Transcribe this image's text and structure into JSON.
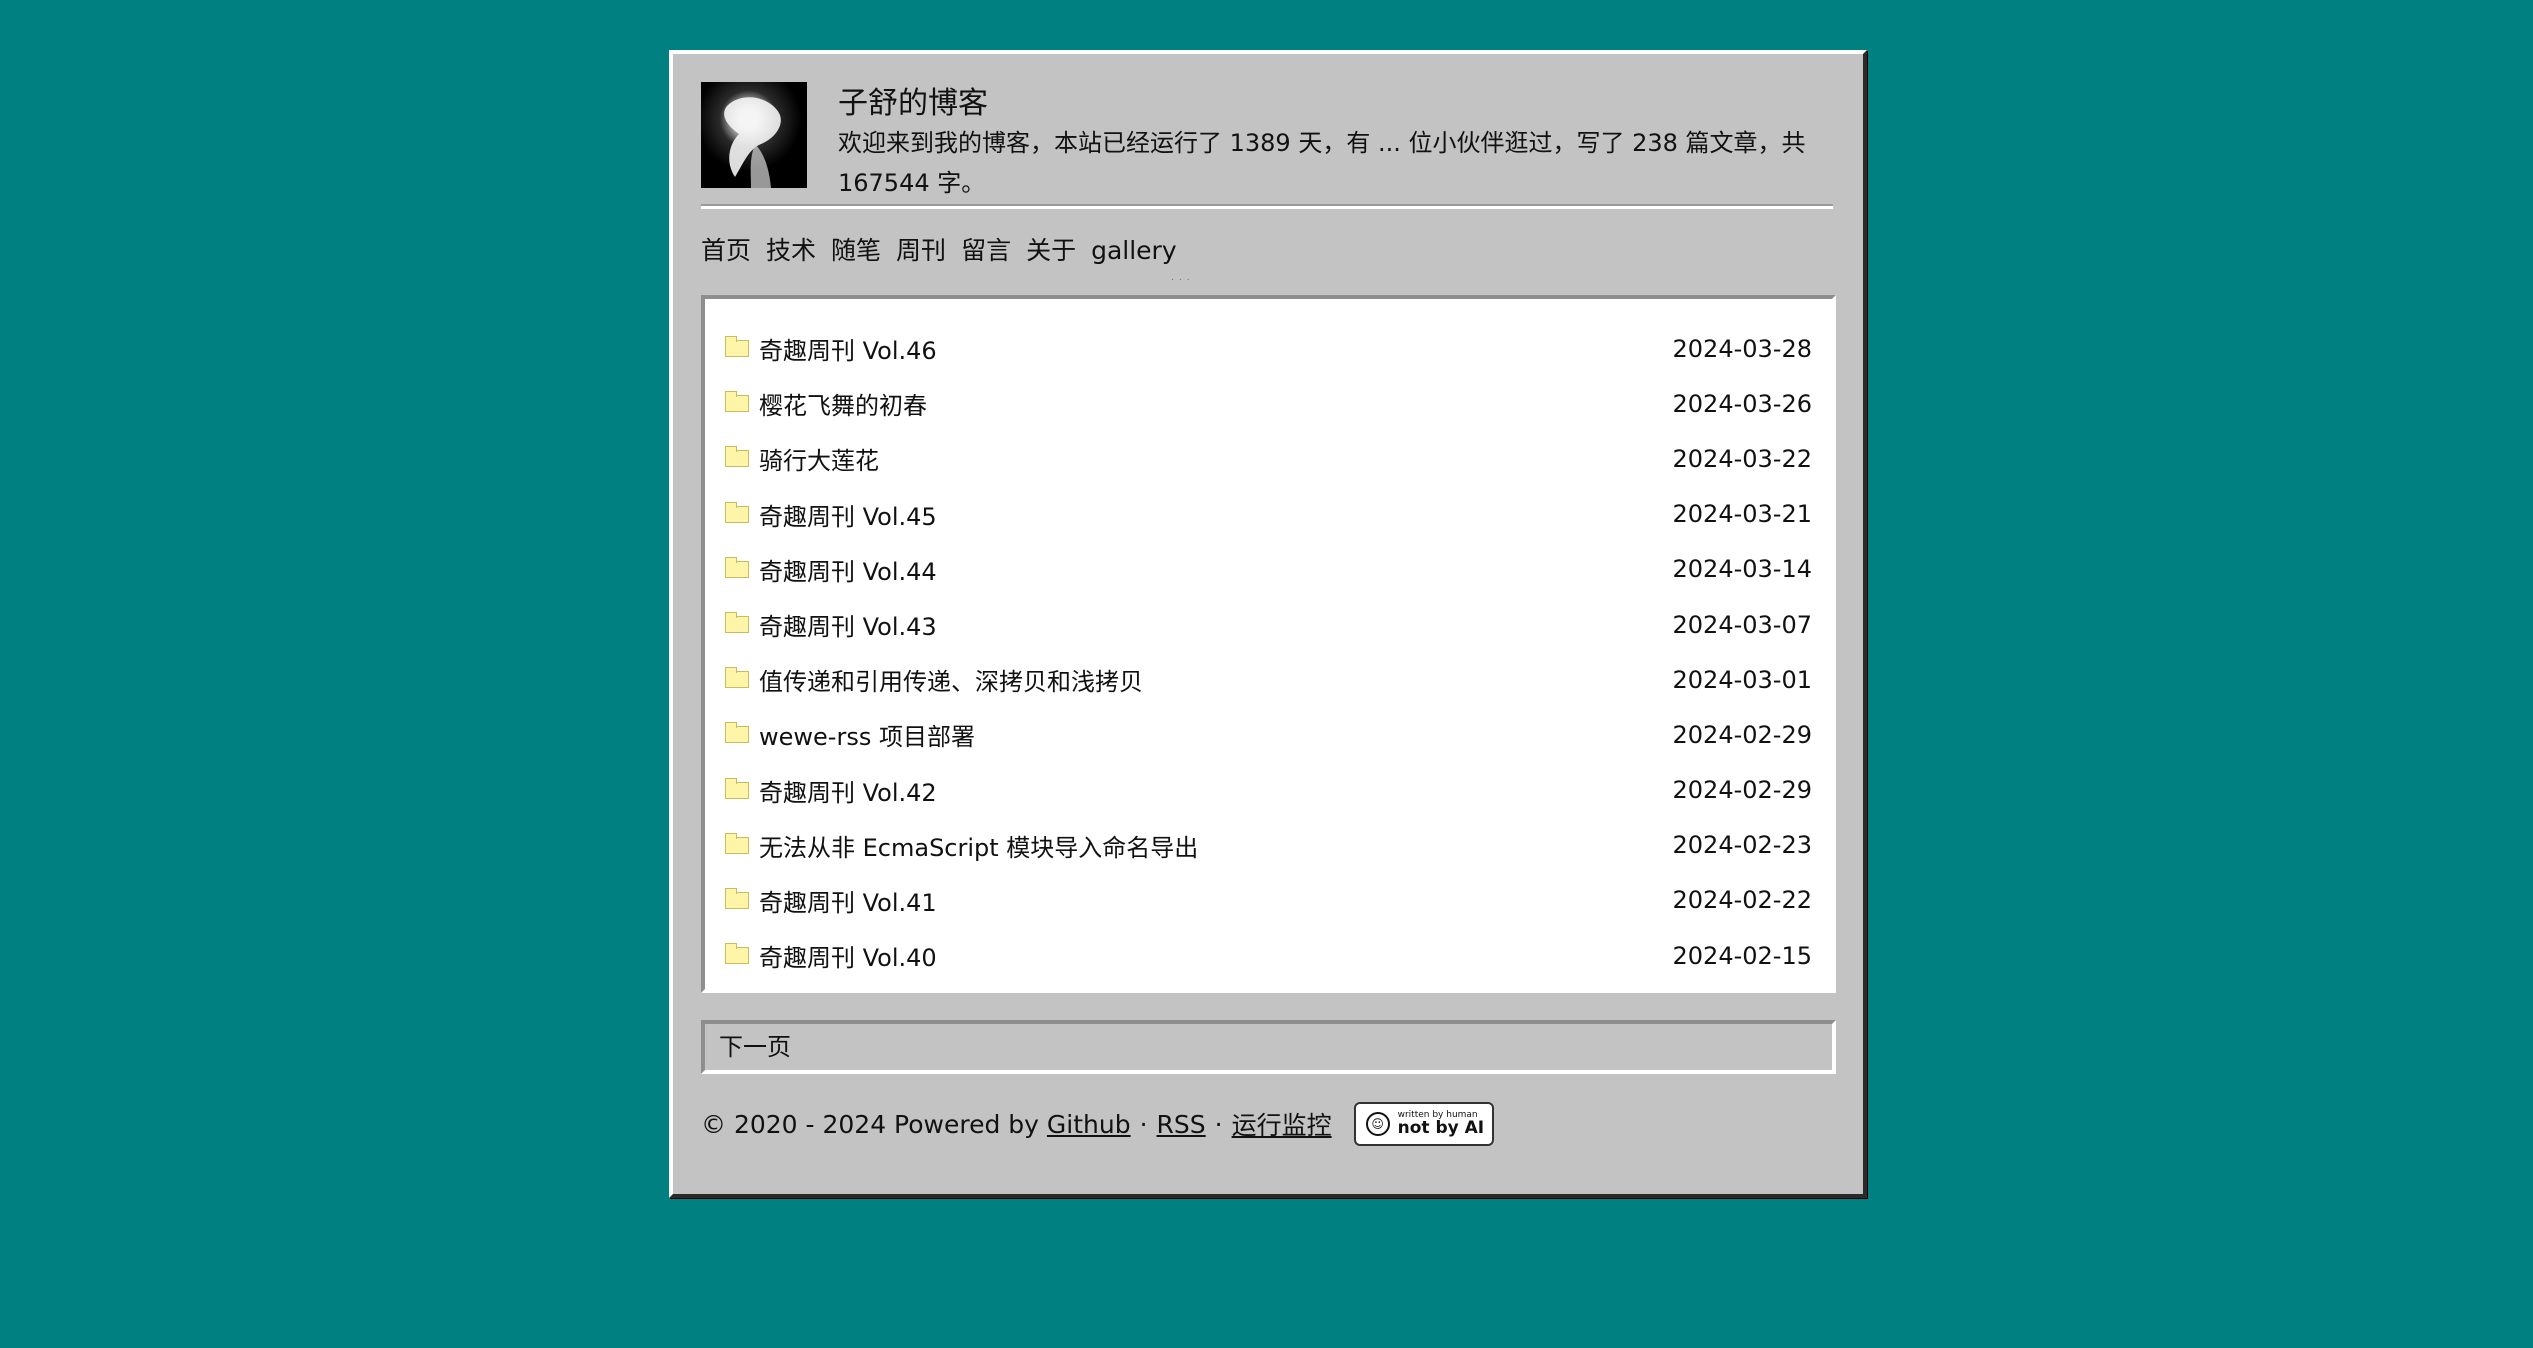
{
  "site": {
    "title": "子舒的博客",
    "description": "欢迎来到我的博客，本站已经运行了 1389 天，有 ... 位小伙伴逛过，写了 238 篇文章，共 167544 字。"
  },
  "nav": [
    "首页",
    "技术",
    "随笔",
    "周刊",
    "留言",
    "关于",
    "gallery"
  ],
  "posts": [
    {
      "title": "奇趣周刊 Vol.46",
      "date": "2024-03-28"
    },
    {
      "title": "樱花飞舞的初春",
      "date": "2024-03-26"
    },
    {
      "title": "骑行大莲花",
      "date": "2024-03-22"
    },
    {
      "title": "奇趣周刊 Vol.45",
      "date": "2024-03-21"
    },
    {
      "title": "奇趣周刊 Vol.44",
      "date": "2024-03-14"
    },
    {
      "title": "奇趣周刊 Vol.43",
      "date": "2024-03-07"
    },
    {
      "title": "值传递和引用传递、深拷贝和浅拷贝",
      "date": "2024-03-01"
    },
    {
      "title": "wewe-rss 项目部署",
      "date": "2024-02-29"
    },
    {
      "title": "奇趣周刊 Vol.42",
      "date": "2024-02-29"
    },
    {
      "title": "无法从非 EcmaScript 模块导入命名导出",
      "date": "2024-02-23"
    },
    {
      "title": "奇趣周刊 Vol.41",
      "date": "2024-02-22"
    },
    {
      "title": "奇趣周刊 Vol.40",
      "date": "2024-02-15"
    }
  ],
  "pager": {
    "next": "下一页"
  },
  "footer": {
    "copyright": "© 2020 - 2024 Powered by",
    "github": "Github",
    "dot": "·",
    "rss": "RSS",
    "monitor": "运行监控",
    "badge_small": "written by human",
    "badge_big": "not by AI"
  },
  "colors": {
    "background": "#008080",
    "window": "#c3c3c3",
    "folder": "#fff5a8"
  },
  "icons": {
    "avatar": "avatar-image",
    "folder": "folder-icon",
    "badge": "smiley-icon"
  }
}
